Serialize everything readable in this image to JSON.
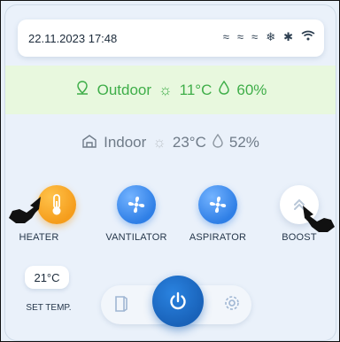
{
  "status": {
    "datetime": "22.11.2023 17:48",
    "icons": [
      "fan-small-icon",
      "fan-medium-icon",
      "fan-large-icon",
      "snowflake-icon",
      "bluetooth-icon",
      "wifi-icon"
    ]
  },
  "outdoor": {
    "label": "Outdoor",
    "temperature": "11°C",
    "humidity": "60%"
  },
  "indoor": {
    "label": "Indoor",
    "temperature": "23°C",
    "humidity": "52%"
  },
  "controls": [
    {
      "label": "HEATER",
      "icon": "thermometer-icon",
      "active": true,
      "color": "#f59d1c"
    },
    {
      "label": "VANTILATOR",
      "icon": "fan-icon",
      "active": true,
      "color": "#2f7fe6"
    },
    {
      "label": "ASPIRATOR",
      "icon": "fan-icon",
      "active": true,
      "color": "#2f7fe6"
    },
    {
      "label": "BOOST",
      "icon": "chevron-up-icon",
      "active": false,
      "color": "#ffffff"
    }
  ],
  "set_temp": {
    "value": "21°C",
    "label": "SET TEMP."
  },
  "dock": {
    "left_icon": "door-icon",
    "center_icon": "power-icon",
    "right_icon": "settings-icon"
  },
  "colors": {
    "accent_blue": "#1962b9",
    "outdoor_green": "#3fae49",
    "heater_orange": "#f59d1c"
  }
}
